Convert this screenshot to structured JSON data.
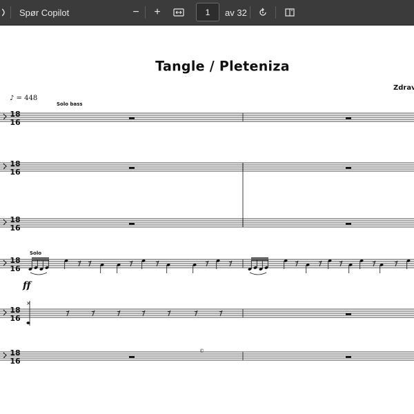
{
  "toolbar": {
    "ask_copilot_label": "Spør Copilot",
    "zoom_out_symbol": "−",
    "zoom_in_symbol": "+",
    "page_number": "1",
    "page_total_label": "av 32",
    "icons": [
      "copilot-icon",
      "zoom-out-icon",
      "zoom-in-icon",
      "fit-width-icon",
      "rotate-icon",
      "page-view-icon"
    ]
  },
  "score": {
    "title": "Tangle / Pleteniza",
    "composer": "Zdravko",
    "tempo": "♪ = 448",
    "solo_bass_label": "Solo bass",
    "solo_label": "Solo",
    "dynamic": "ff",
    "time_signature_top": "18",
    "time_signature_bottom": "16",
    "copyright_symbol": "©",
    "staff_count": 6
  },
  "colors": {
    "toolbar_bg": "#3b3b3b",
    "toolbar_text": "#e8e8e8",
    "page_bg": "#ffffff",
    "ink": "#111111"
  }
}
